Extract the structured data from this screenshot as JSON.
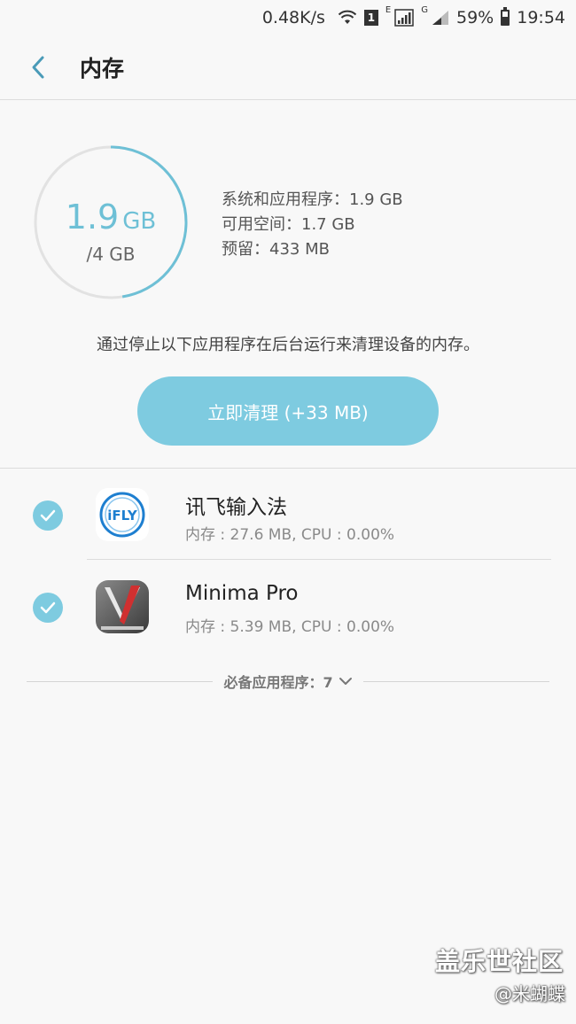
{
  "status_bar": {
    "speed": "0.48K/s",
    "sim_badge": "1",
    "net_label_1": "E",
    "net_label_2": "G",
    "battery": "59%",
    "time": "19:54"
  },
  "header": {
    "title": "内存",
    "back_icon": "chevron-left-icon"
  },
  "summary": {
    "used_value": "1.9",
    "used_unit": "GB",
    "total": "/4 GB",
    "used_fraction": 0.475,
    "ring_color": "#6ec0d6",
    "stats": [
      "系统和应用程序：1.9 GB",
      "可用空间：1.7 GB",
      "预留：433 MB"
    ]
  },
  "hint": "通过停止以下应用程序在后台运行来清理设备的内存。",
  "clean_button": "立即清理 (+33 MB)",
  "apps": [
    {
      "name": "讯飞输入法",
      "usage": "内存 : 27.6 MB, CPU : 0.00%",
      "checked": true,
      "icon": "ifly-icon"
    },
    {
      "name": "Minima Pro",
      "usage": "内存 : 5.39 MB, CPU : 0.00%",
      "checked": true,
      "icon": "minima-pro-icon"
    }
  ],
  "essential": {
    "label": "必备应用程序：7",
    "icon": "chevron-down-icon"
  },
  "watermark": {
    "title": "盖乐世社区",
    "sub": "@米蝴蝶"
  },
  "colors": {
    "accent": "#7ecbe0",
    "background": "#f8f8f8"
  }
}
